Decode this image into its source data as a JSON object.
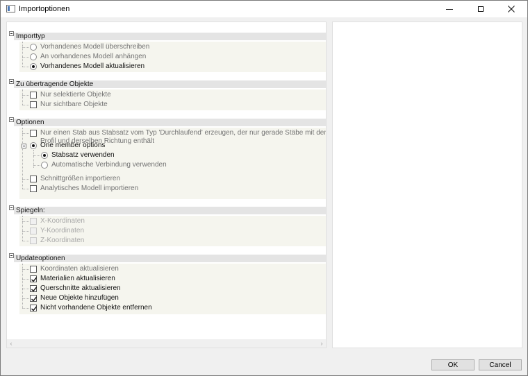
{
  "window": {
    "title": "Importoptionen"
  },
  "sections": {
    "importtyp": {
      "title": "Importtyp",
      "items": [
        {
          "label": "Vorhandenes Modell überschreiben",
          "checked": false
        },
        {
          "label": "An vorhandenes Modell anhängen",
          "checked": false
        },
        {
          "label": "Vorhandenes Modell aktualisieren",
          "checked": true
        }
      ]
    },
    "zu_uebertragende": {
      "title": "Zu übertragende Objekte",
      "items": [
        {
          "label": "Nur selektierte Objekte",
          "checked": false
        },
        {
          "label": "Nur sichtbare Objekte",
          "checked": false
        }
      ]
    },
    "optionen": {
      "title": "Optionen",
      "stab_line1": "Nur einen Stab aus Stabsatz vom Typ 'Durchlaufend' erzeugen, der nur gerade Stäbe mit demselbe",
      "stab_line2": "Profil und derselben Richtung enthält",
      "one_member": "One member options",
      "stabsatz": "Stabsatz verwenden",
      "auto_verbindung": "Automatische Verbindung verwenden",
      "schnittgroessen": "Schnittgrößen importieren",
      "analytisch": "Analytisches Modell importieren"
    },
    "spiegeln": {
      "title": "Spiegeln:",
      "items": [
        {
          "label": "X-Koordinaten"
        },
        {
          "label": "Y-Koordinaten"
        },
        {
          "label": "Z-Koordinaten"
        }
      ]
    },
    "updateoptionen": {
      "title": "Updateoptionen",
      "items": [
        {
          "label": "Koordinaten aktualisieren",
          "checked": false
        },
        {
          "label": "Materialien aktualisieren",
          "checked": true
        },
        {
          "label": "Querschnitte aktualisieren",
          "checked": true
        },
        {
          "label": "Neue Objekte hinzufügen",
          "checked": true
        },
        {
          "label": "Nicht vorhandene Objekte entfernen",
          "checked": true
        }
      ]
    }
  },
  "buttons": {
    "ok": "OK",
    "cancel": "Cancel"
  },
  "icons": {
    "app": "window-icon",
    "minimize": "minimize-icon",
    "maximize": "maximize-icon",
    "close": "close-icon",
    "collapse": "minus-box-icon",
    "scroll_left": "‹",
    "scroll_right": "›"
  }
}
